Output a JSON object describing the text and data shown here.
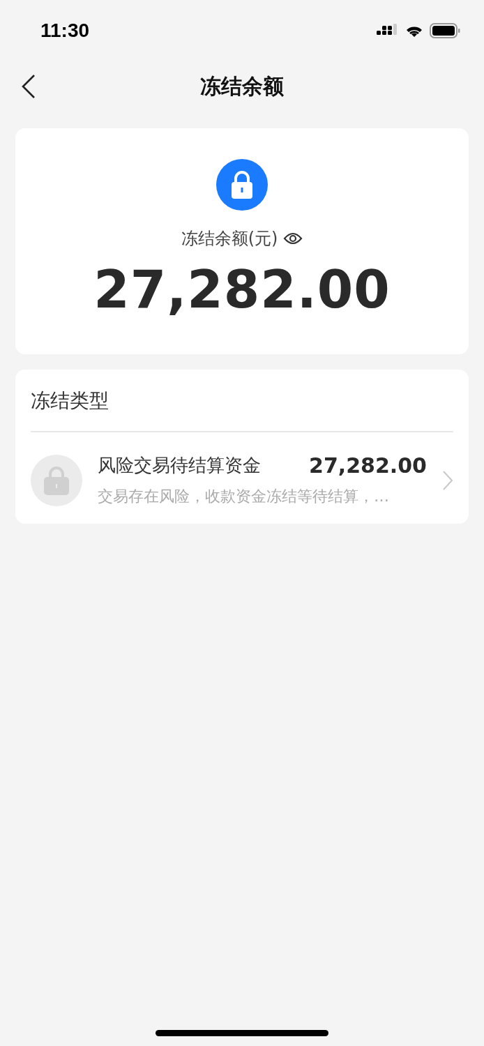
{
  "status_bar": {
    "time": "11:30"
  },
  "nav": {
    "title": "冻结余额"
  },
  "summary": {
    "label": "冻结余额(元)",
    "amount": "27,282.00"
  },
  "types": {
    "title": "冻结类型",
    "items": [
      {
        "name": "风险交易待结算资金",
        "amount": "27,282.00",
        "description": "交易存在风险，收款资金冻结等待结算，…"
      }
    ]
  }
}
